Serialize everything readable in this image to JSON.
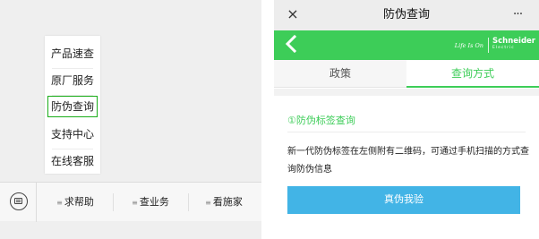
{
  "left_pane": {
    "popup_menu": {
      "items": [
        {
          "label": "产品速查",
          "selected": false
        },
        {
          "label": "原厂服务",
          "selected": false
        },
        {
          "label": "防伪查询",
          "selected": true
        },
        {
          "label": "支持中心",
          "selected": false
        },
        {
          "label": "在线客服",
          "selected": false
        }
      ]
    },
    "bottom_bar": {
      "keyboard_icon": "keyboard-icon",
      "menus": [
        {
          "label": "求帮助"
        },
        {
          "label": "查业务"
        },
        {
          "label": "看施家"
        }
      ]
    }
  },
  "right_pane": {
    "window_title": "防伪查询",
    "close_glyph": "×",
    "more_glyph": "···",
    "brand": {
      "tagline": "Life Is On",
      "name": "Schneider",
      "sub": "Electric",
      "bar_color": "#3dcd58"
    },
    "tabs": [
      {
        "label": "政策",
        "active": false
      },
      {
        "label": "查询方式",
        "active": true
      }
    ],
    "section_heading": "①防伪标签查询",
    "description": "新一代防伪标签在左侧附有二维码，可通过手机扫描的方式查询防伪信息",
    "verify_button": {
      "label": "真伪我验",
      "color": "#42b4e6"
    }
  }
}
